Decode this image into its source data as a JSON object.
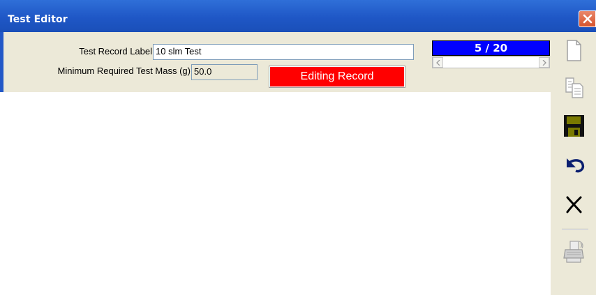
{
  "window": {
    "title": "Test Editor"
  },
  "form": {
    "record_label": {
      "label": "Test Record Label",
      "value": "10 slm Test"
    },
    "min_mass": {
      "label": "Minimum Required Test Mass (g)",
      "value": "50.0"
    },
    "status": "Editing Record"
  },
  "navigator": {
    "counter": "5 / 20",
    "current": 5,
    "total": 20
  },
  "toolbar": {
    "items": [
      "new-record-icon",
      "copy-record-icon",
      "save-icon",
      "undo-icon",
      "delete-icon",
      "print-icon"
    ]
  },
  "colors": {
    "titlebar": "#1f57c6",
    "status_bg": "#ff0000",
    "counter_bg": "#0000ff",
    "panel_bg": "#ece9d8",
    "close_btn": "#d6542e"
  }
}
